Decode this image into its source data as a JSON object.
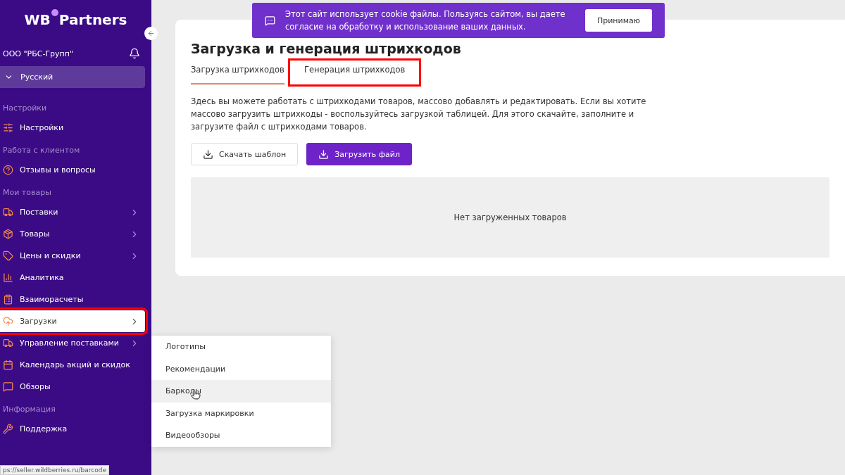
{
  "sidebar": {
    "logo": {
      "left": "WB",
      "right": "Partners"
    },
    "company": "ООО \"РБС-Групп\"",
    "language": "Русский",
    "sections": [
      {
        "title": "Настройки",
        "items": [
          {
            "label": "Настройки",
            "submenu": false,
            "selected": false,
            "highlighted": false
          }
        ]
      },
      {
        "title": "Работа с клиентом",
        "items": [
          {
            "label": "Отзывы и вопросы",
            "submenu": false,
            "selected": false,
            "highlighted": false
          }
        ]
      },
      {
        "title": "Мои товары",
        "items": [
          {
            "label": "Поставки",
            "submenu": true,
            "selected": false,
            "highlighted": false
          },
          {
            "label": "Товары",
            "submenu": true,
            "selected": false,
            "highlighted": false
          },
          {
            "label": "Цены и скидки",
            "submenu": true,
            "selected": false,
            "highlighted": false
          },
          {
            "label": "Аналитика",
            "submenu": false,
            "selected": false,
            "highlighted": false
          },
          {
            "label": "Взаиморасчеты",
            "submenu": false,
            "selected": false,
            "highlighted": false
          },
          {
            "label": "Загрузки",
            "submenu": true,
            "selected": true,
            "highlighted": true
          },
          {
            "label": "Управление поставками",
            "submenu": true,
            "selected": false,
            "highlighted": false
          },
          {
            "label": "Календарь акций и скидок",
            "submenu": false,
            "selected": false,
            "highlighted": false
          },
          {
            "label": "Обзоры",
            "submenu": false,
            "selected": false,
            "highlighted": false
          }
        ]
      },
      {
        "title": "Информация",
        "items": [
          {
            "label": "Поддержка",
            "submenu": false,
            "selected": false,
            "highlighted": false
          }
        ]
      }
    ]
  },
  "submenu": [
    {
      "label": "Логотипы",
      "selected": false
    },
    {
      "label": "Рекомендации",
      "selected": false
    },
    {
      "label": "Баркоды",
      "selected": true
    },
    {
      "label": "Загрузка маркировки",
      "selected": false
    },
    {
      "label": "Видеообзоры",
      "selected": false
    }
  ],
  "status_url": "ps://seller.wildberries.ru/barcode",
  "cookie_banner": {
    "text": "Этот сайт использует cookie файлы. Пользуясь сайтом, вы даете согласие на обработку и использование ваших данных.",
    "button": "Принимаю"
  },
  "page": {
    "title": "Загрузка и генерация штрихкодов",
    "tabs": [
      {
        "label": "Загрузка штрихкодов",
        "selected": true,
        "highlighted": false
      },
      {
        "label": "Генерация штрихкодов",
        "selected": false,
        "highlighted": true
      }
    ],
    "description": "Здесь вы можете работать с штрихкодами товаров, массово добавлять и редактировать. Если вы хотите массово загрузить штрихкоды - воспользуйтесь загрузкой таблицей. Для этого скачайте, заполните и загрузите файл с штрихкодами товаров.",
    "buttons": [
      {
        "label": "Скачать шаблон",
        "kind": "secondary"
      },
      {
        "label": "Загрузить файл",
        "kind": "primary"
      }
    ],
    "empty_text": "Нет загруженных товаров"
  }
}
